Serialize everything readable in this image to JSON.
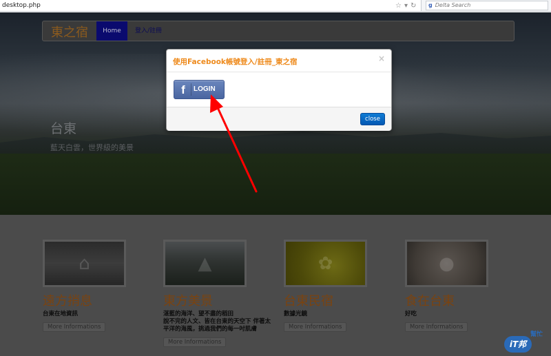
{
  "browser": {
    "url": "desktop.php",
    "search_engine": "g",
    "search_placeholder": "Delta Search"
  },
  "nav": {
    "brand": "東之宿",
    "home": "Home",
    "login": "登入/註冊"
  },
  "hero": {
    "title": "台東",
    "subtitle": "藍天白雲，世界級的美景"
  },
  "cards": [
    {
      "title": "遠方捎息",
      "desc": "台東在地資訊",
      "more": "More Informations"
    },
    {
      "title": "東方美景",
      "desc": "湛藍的海洋、望不盡的稻田\n說不完的人文、皆在台東的天空下 伴著太平洋的海風，挑過我們的每一吋肌膚",
      "more": "More Informations"
    },
    {
      "title": "台東民宿",
      "desc": "數據光鏡",
      "more": "More Informations"
    },
    {
      "title": "食在台東",
      "desc": "好吃",
      "more": "More Informations"
    }
  ],
  "modal": {
    "title": "使用Facebook帳號登入/註冊_東之宿",
    "close_x": "×",
    "fb_icon": "f",
    "fb_label": "LOGIN",
    "close_button": "close"
  },
  "watermark": {
    "badge": "iT邦",
    "text": "幫忙"
  },
  "colors": {
    "modal_title": "#ee8a1c",
    "facebook_blue": "#4a65a0",
    "close_button": "#0458b3",
    "arrow": "#ff0000"
  }
}
